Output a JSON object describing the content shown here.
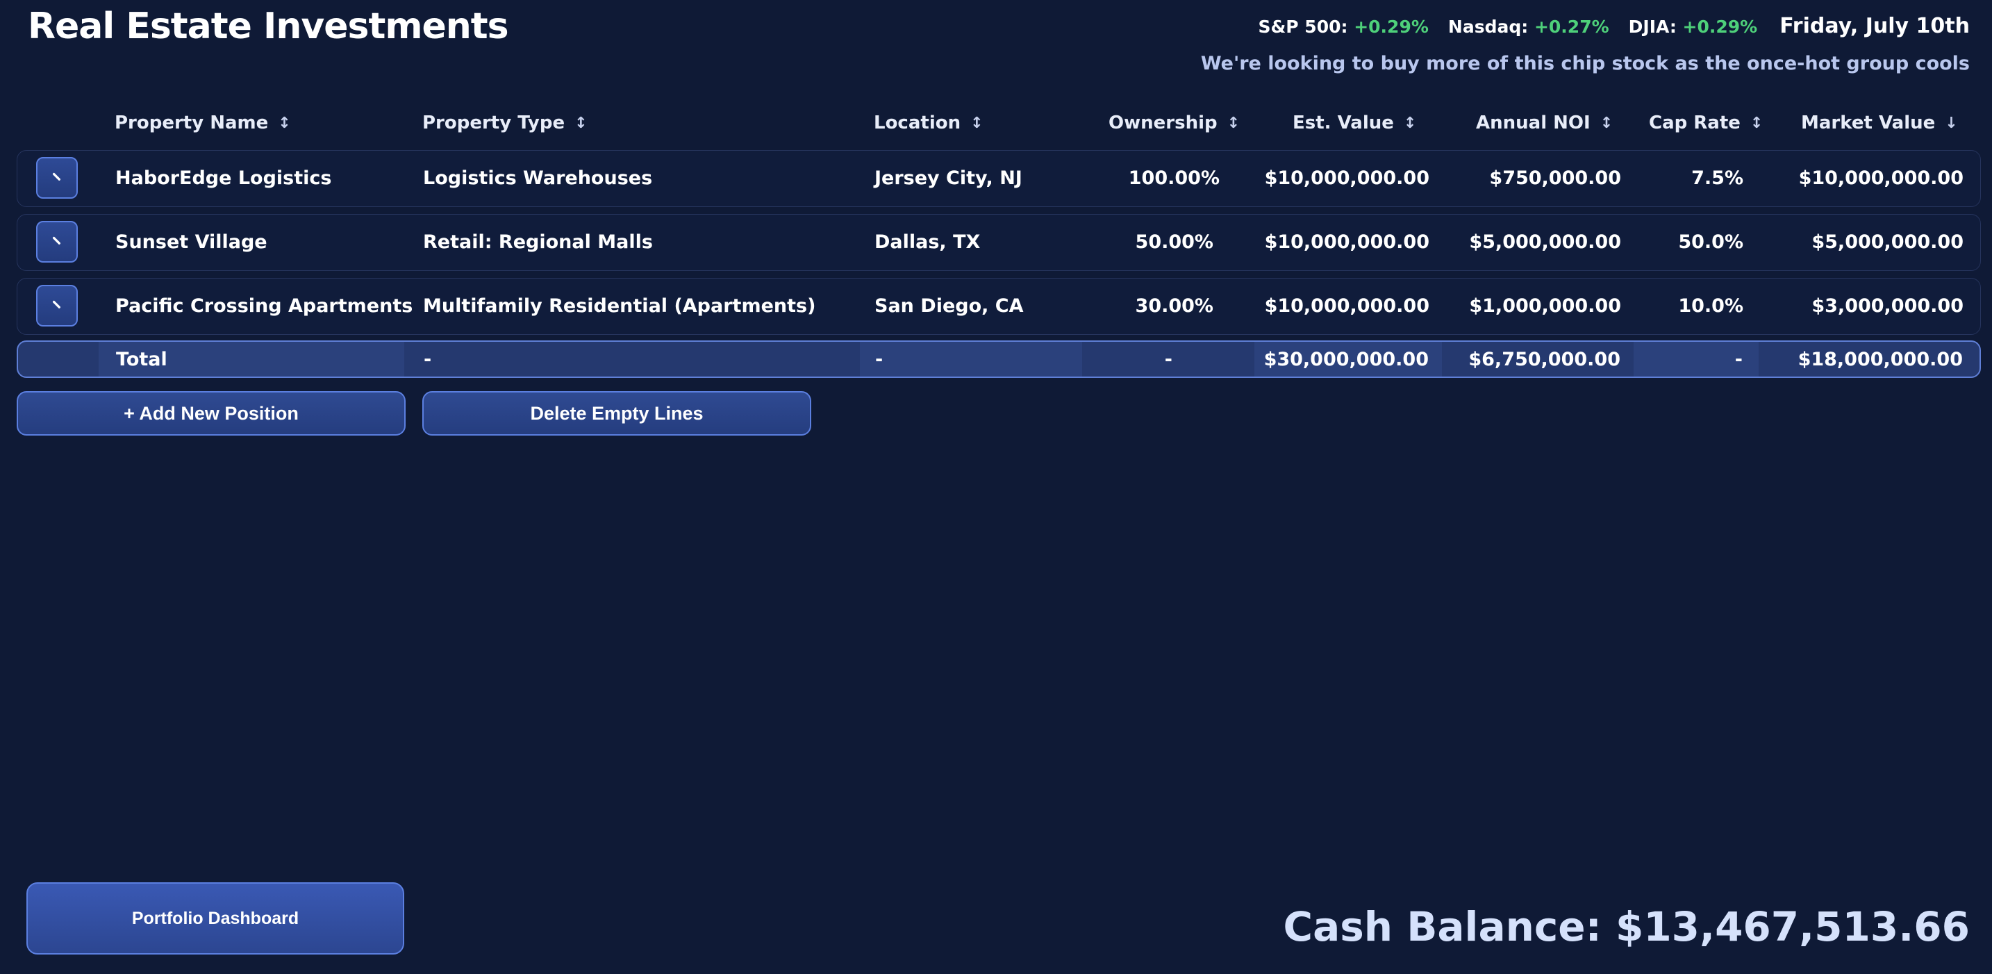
{
  "header": {
    "title": "Real Estate Investments",
    "tickers": [
      {
        "label": "S&P 500:",
        "change": "+0.29%"
      },
      {
        "label": "Nasdaq:",
        "change": "+0.27%"
      },
      {
        "label": "DJIA:",
        "change": "+0.29%"
      }
    ],
    "date": "Friday, July 10th",
    "headline": "We're looking to buy more of this chip stock as the once-hot group cools"
  },
  "table": {
    "columns": [
      {
        "label": "Property Name",
        "sort_icon": "↕"
      },
      {
        "label": "Property Type",
        "sort_icon": "↕"
      },
      {
        "label": "Location",
        "sort_icon": "↕"
      },
      {
        "label": "Ownership",
        "sort_icon": "↕"
      },
      {
        "label": "Est. Value",
        "sort_icon": "↕"
      },
      {
        "label": "Annual NOI",
        "sort_icon": "↕"
      },
      {
        "label": "Cap Rate",
        "sort_icon": "↕"
      },
      {
        "label": "Market Value",
        "sort_icon": "↓"
      }
    ],
    "rows": [
      {
        "name": "HaborEdge Logistics",
        "type": "Logistics Warehouses",
        "location": "Jersey City, NJ",
        "ownership": "100.00%",
        "est_value": "$10,000,000.00",
        "noi": "$750,000.00",
        "cap_rate": "7.5%",
        "market_value": "$10,000,000.00"
      },
      {
        "name": "Sunset Village",
        "type": "Retail: Regional Malls",
        "location": "Dallas, TX",
        "ownership": "50.00%",
        "est_value": "$10,000,000.00",
        "noi": "$5,000,000.00",
        "cap_rate": "50.0%",
        "market_value": "$5,000,000.00"
      },
      {
        "name": "Pacific Crossing Apartments",
        "type": "Multifamily Residential (Apartments)",
        "location": "San Diego, CA",
        "ownership": "30.00%",
        "est_value": "$10,000,000.00",
        "noi": "$1,000,000.00",
        "cap_rate": "10.0%",
        "market_value": "$3,000,000.00"
      }
    ],
    "total": {
      "name": "Total",
      "type": "-",
      "location": "-",
      "ownership": "-",
      "est_value": "$30,000,000.00",
      "noi": "$6,750,000.00",
      "cap_rate": "-",
      "market_value": "$18,000,000.00"
    }
  },
  "actions": {
    "add_label": "+ Add New Position",
    "delete_label": "Delete Empty Lines"
  },
  "footer": {
    "dashboard_label": "Portfolio Dashboard",
    "cash_balance": "Cash Balance: $13,467,513.66"
  },
  "colors": {
    "background": "#0f1a36",
    "accent": "#5b7fe0",
    "positive": "#4ed07a"
  },
  "icons": {
    "edit": "pencil-icon",
    "sort": "sort-arrows-icon",
    "sort_active": "sort-down-icon"
  }
}
